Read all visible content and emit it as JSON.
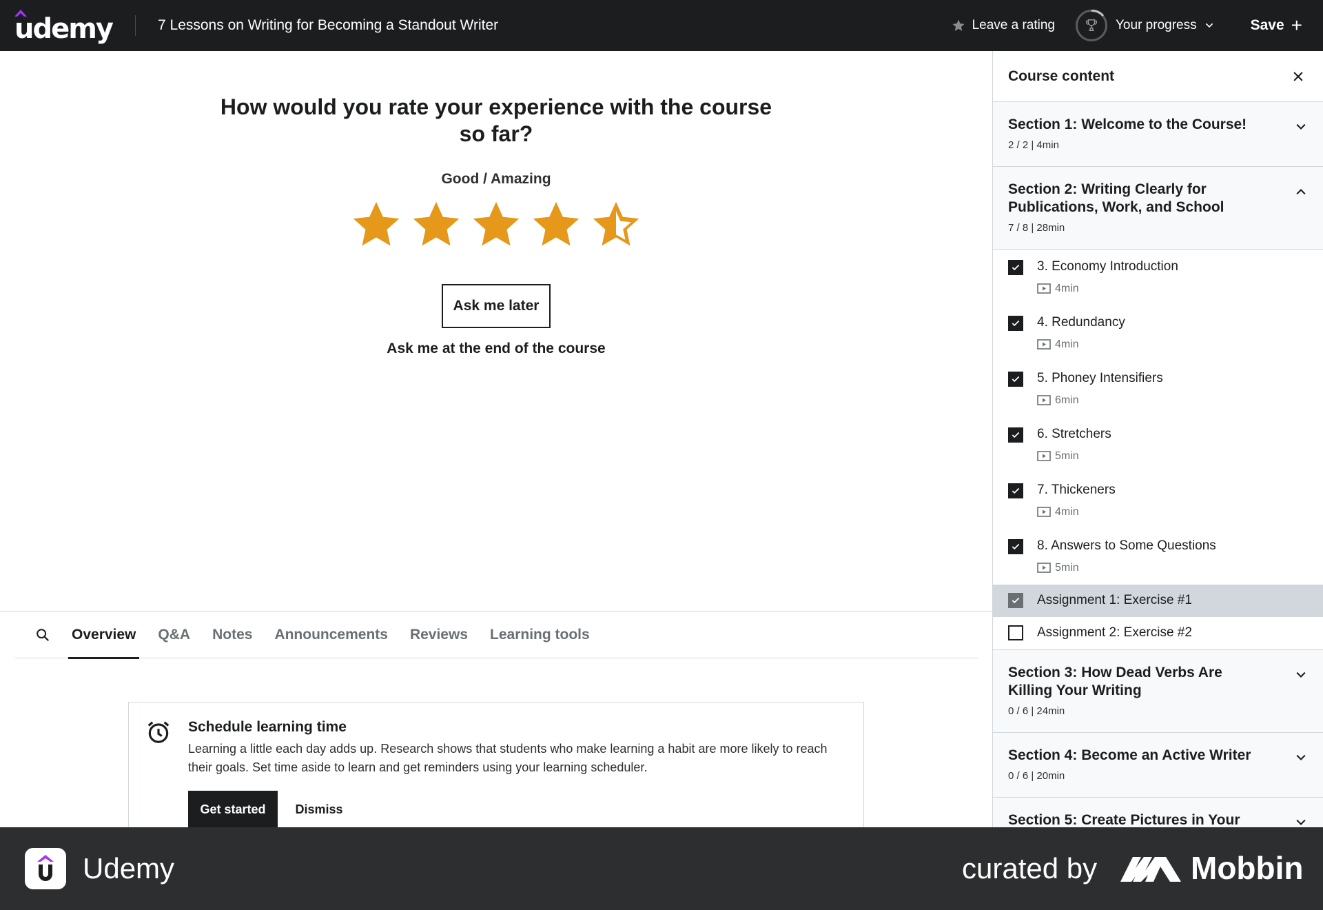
{
  "header": {
    "logo_text": "udemy",
    "course_title": "7 Lessons on Writing for Becoming a Standout Writer",
    "leave_rating": "Leave a rating",
    "your_progress": "Your progress",
    "save": "Save"
  },
  "rating": {
    "question": "How would you rate your experience with the course so far?",
    "current_label": "Good / Amazing",
    "value": 4.5,
    "max": 5,
    "ask_later": "Ask me later",
    "ask_end": "Ask me at the end of the course",
    "star_color": "#e59819"
  },
  "tabs": [
    {
      "label": "Overview",
      "active": true
    },
    {
      "label": "Q&A"
    },
    {
      "label": "Notes"
    },
    {
      "label": "Announcements"
    },
    {
      "label": "Reviews"
    },
    {
      "label": "Learning tools"
    }
  ],
  "schedule": {
    "title": "Schedule learning time",
    "body": "Learning a little each day adds up. Research shows that students who make learning a habit are more likely to reach their goals. Set time aside to learn and get reminders using your learning scheduler.",
    "get_started": "Get started",
    "dismiss": "Dismiss"
  },
  "sidebar": {
    "title": "Course content",
    "sections": [
      {
        "title": "Section 1: Welcome to the Course!",
        "meta": "2 / 2 | 4min",
        "expanded": false
      },
      {
        "title": "Section 2: Writing Clearly for Publications, Work, and School",
        "meta": "7 / 8 | 28min",
        "expanded": true
      },
      {
        "title": "Section 3: How Dead Verbs Are Killing Your Writing",
        "meta": "0 / 6 | 24min",
        "expanded": false
      },
      {
        "title": "Section 4: Become an Active Writer",
        "meta": "0 / 6 | 20min",
        "expanded": false
      },
      {
        "title": "Section 5: Create Pictures in Your",
        "meta": "",
        "expanded": false
      }
    ],
    "lectures": [
      {
        "title": "3. Economy Introduction",
        "duration": "4min",
        "completed": true
      },
      {
        "title": "4. Redundancy",
        "duration": "4min",
        "completed": true
      },
      {
        "title": "5. Phoney Intensifiers",
        "duration": "6min",
        "completed": true
      },
      {
        "title": "6. Stretchers",
        "duration": "5min",
        "completed": true
      },
      {
        "title": "7. Thickeners",
        "duration": "4min",
        "completed": true
      },
      {
        "title": "8. Answers to Some Questions",
        "duration": "5min",
        "completed": true
      }
    ],
    "assignments": [
      {
        "title": "Assignment 1: Exercise #1",
        "completed": true,
        "current": true
      },
      {
        "title": "Assignment 2: Exercise #2",
        "completed": false,
        "current": false
      }
    ]
  },
  "footer": {
    "app_name": "Udemy",
    "curated_by": "curated by",
    "brand": "Mobbin"
  },
  "colors": {
    "topbar": "#1c1d1f",
    "brand_purple": "#a435f0",
    "footer": "#2d2e30"
  }
}
